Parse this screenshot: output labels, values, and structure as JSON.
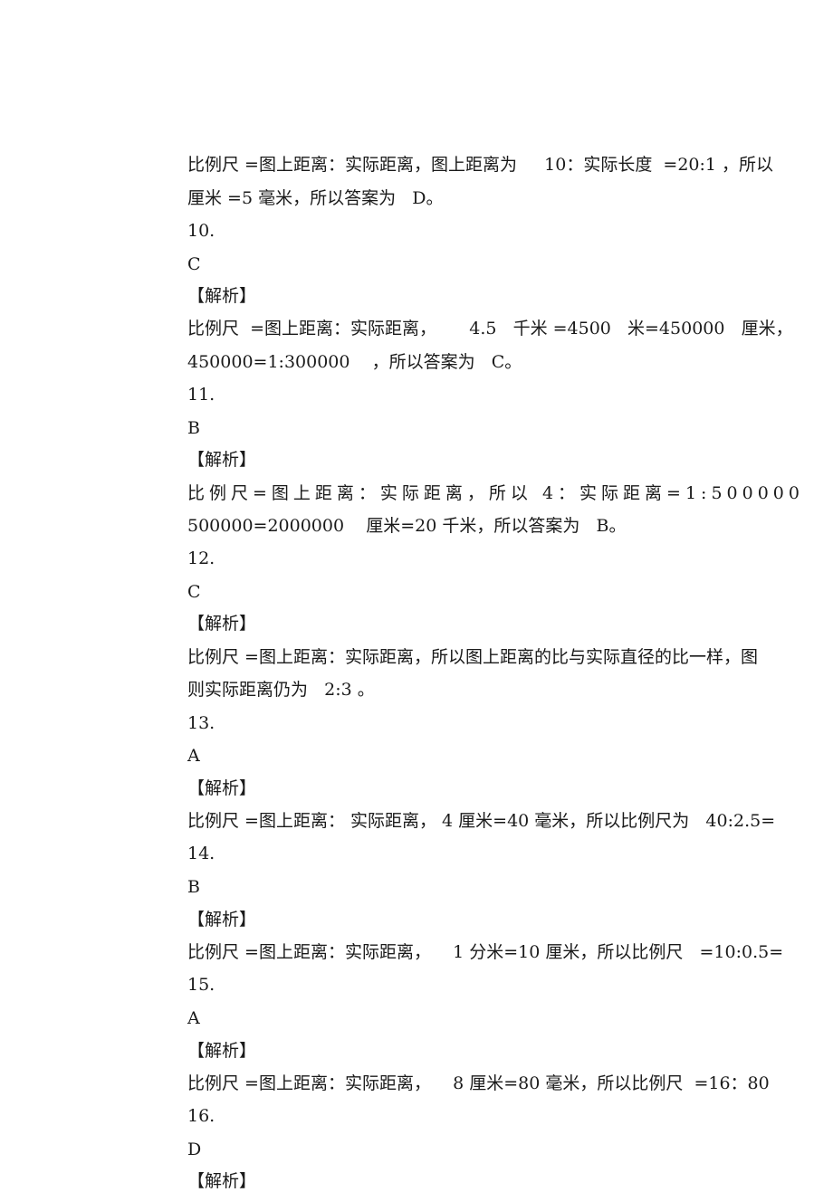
{
  "document": {
    "lines": [
      "比例尺 =图上距离：实际距离，图上距离为     10：实际长度  =20:1 ，所以",
      "厘米 =5 毫米，所以答案为   D。",
      "10.",
      "C",
      "【解析】",
      "比例尺  =图上距离：实际距离，      4.5   千米 =4500   米=450000   厘米，",
      "450000=1:300000    ，所以答案为   C。",
      "11.",
      "B",
      "【解析】",
      "比例尺=图上距离：实际距离，所以 4：实际距离=1:500000",
      "500000=2000000    厘米=20 千米，所以答案为   B。",
      "12.",
      "C",
      "【解析】",
      "比例尺 =图上距离：实际距离，所以图上距离的比与实际直径的比一样，图",
      "则实际距离仍为   2:3 。",
      "13.",
      "A",
      "【解析】",
      "比例尺 =图上距离： 实际距离， 4 厘米=40 毫米，所以比例尺为   40:2.5=",
      "14.",
      "B",
      "【解析】",
      "比例尺 =图上距离：实际距离，    1 分米=10 厘米，所以比例尺   =10:0.5=",
      "15.",
      "A",
      "【解析】",
      "比例尺 =图上距离：实际距离，    8 厘米=80 毫米，所以比例尺  =16：80",
      "16.",
      "D",
      "【解析】"
    ]
  }
}
